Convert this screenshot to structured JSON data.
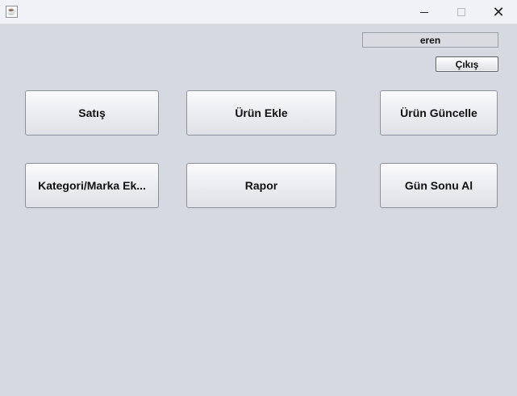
{
  "window": {
    "app_icon": "java-cup-icon",
    "controls": {
      "minimize": "minimize-icon",
      "maximize": "maximize-icon",
      "close_symbol": "✕"
    }
  },
  "header": {
    "username": "eren",
    "logout_label": "Çıkış"
  },
  "menu": {
    "buttons": [
      {
        "label": "Satış"
      },
      {
        "label": "Ürün Ekle"
      },
      {
        "label": "Ürün Güncelle"
      },
      {
        "label": "Kategori/Marka Ek..."
      },
      {
        "label": "Rapor"
      },
      {
        "label": "Gün Sonu Al"
      }
    ]
  },
  "colors": {
    "background": "#d6d9e0",
    "titlebar": "#f0f2f8"
  }
}
